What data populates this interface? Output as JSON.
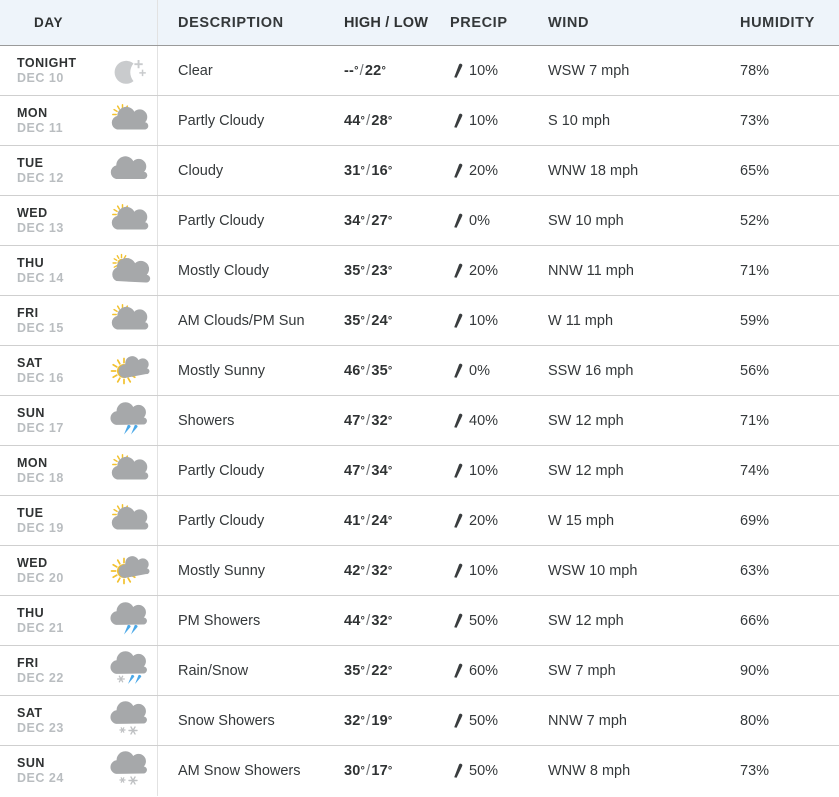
{
  "table": {
    "columns": [
      {
        "key": "day",
        "label": "DAY"
      },
      {
        "key": "desc",
        "label": "DESCRIPTION"
      },
      {
        "key": "temp",
        "label": "HIGH / LOW"
      },
      {
        "key": "precip",
        "label": "PRECIP"
      },
      {
        "key": "wind",
        "label": "WIND"
      },
      {
        "key": "humidity",
        "label": "HUMIDITY"
      }
    ]
  },
  "colors": {
    "header_background": "#eef4fa",
    "cloud_gray": "#a6a8aa",
    "moon_gray": "#c9cbcd",
    "sun_yellow": "#f2c12e",
    "rain_blue": "#4aa8e8",
    "snow_gray": "#bfc1c3",
    "text_primary": "#2f3233",
    "text_muted": "#b9bdc0",
    "row_border": "#cfcfcf"
  },
  "rows": [
    {
      "day": "TONIGHT",
      "date": "DEC 10",
      "icon": "moon-stars-icon",
      "desc": "Clear",
      "high": "--",
      "low": "22",
      "precip": "10%",
      "wind": "WSW 7 mph",
      "humidity": "78%"
    },
    {
      "day": "MON",
      "date": "DEC 11",
      "icon": "sun-behind-cloud-icon",
      "desc": "Partly Cloudy",
      "high": "44",
      "low": "28",
      "precip": "10%",
      "wind": "S 10 mph",
      "humidity": "73%"
    },
    {
      "day": "TUE",
      "date": "DEC 12",
      "icon": "cloud-icon",
      "desc": "Cloudy",
      "high": "31",
      "low": "16",
      "precip": "20%",
      "wind": "WNW 18 mph",
      "humidity": "65%"
    },
    {
      "day": "WED",
      "date": "DEC 13",
      "icon": "sun-behind-cloud-icon",
      "desc": "Partly Cloudy",
      "high": "34",
      "low": "27",
      "precip": "0%",
      "wind": "SW 10 mph",
      "humidity": "52%"
    },
    {
      "day": "THU",
      "date": "DEC 14",
      "icon": "sun-behind-large-cloud-icon",
      "desc": "Mostly Cloudy",
      "high": "35",
      "low": "23",
      "precip": "20%",
      "wind": "NNW 11 mph",
      "humidity": "71%"
    },
    {
      "day": "FRI",
      "date": "DEC 15",
      "icon": "sun-behind-cloud-icon",
      "desc": "AM Clouds/PM Sun",
      "high": "35",
      "low": "24",
      "precip": "10%",
      "wind": "W 11 mph",
      "humidity": "59%"
    },
    {
      "day": "SAT",
      "date": "DEC 16",
      "icon": "sun-with-small-cloud-icon",
      "desc": "Mostly Sunny",
      "high": "46",
      "low": "35",
      "precip": "0%",
      "wind": "SSW 16 mph",
      "humidity": "56%"
    },
    {
      "day": "SUN",
      "date": "DEC 17",
      "icon": "rain-cloud-icon",
      "desc": "Showers",
      "high": "47",
      "low": "32",
      "precip": "40%",
      "wind": "SW 12 mph",
      "humidity": "71%"
    },
    {
      "day": "MON",
      "date": "DEC 18",
      "icon": "sun-behind-cloud-icon",
      "desc": "Partly Cloudy",
      "high": "47",
      "low": "34",
      "precip": "10%",
      "wind": "SW 12 mph",
      "humidity": "74%"
    },
    {
      "day": "TUE",
      "date": "DEC 19",
      "icon": "sun-behind-cloud-icon",
      "desc": "Partly Cloudy",
      "high": "41",
      "low": "24",
      "precip": "20%",
      "wind": "W 15 mph",
      "humidity": "69%"
    },
    {
      "day": "WED",
      "date": "DEC 20",
      "icon": "sun-with-small-cloud-icon",
      "desc": "Mostly Sunny",
      "high": "42",
      "low": "32",
      "precip": "10%",
      "wind": "WSW 10 mph",
      "humidity": "63%"
    },
    {
      "day": "THU",
      "date": "DEC 21",
      "icon": "rain-cloud-icon",
      "desc": "PM Showers",
      "high": "44",
      "low": "32",
      "precip": "50%",
      "wind": "SW 12 mph",
      "humidity": "66%"
    },
    {
      "day": "FRI",
      "date": "DEC 22",
      "icon": "rain-snow-cloud-icon",
      "desc": "Rain/Snow",
      "high": "35",
      "low": "22",
      "precip": "60%",
      "wind": "SW 7 mph",
      "humidity": "90%"
    },
    {
      "day": "SAT",
      "date": "DEC 23",
      "icon": "snow-cloud-icon",
      "desc": "Snow Showers",
      "high": "32",
      "low": "19",
      "precip": "50%",
      "wind": "NNW 7 mph",
      "humidity": "80%"
    },
    {
      "day": "SUN",
      "date": "DEC 24",
      "icon": "snow-cloud-icon",
      "desc": "AM Snow Showers",
      "high": "30",
      "low": "17",
      "precip": "50%",
      "wind": "WNW 8 mph",
      "humidity": "73%"
    }
  ]
}
